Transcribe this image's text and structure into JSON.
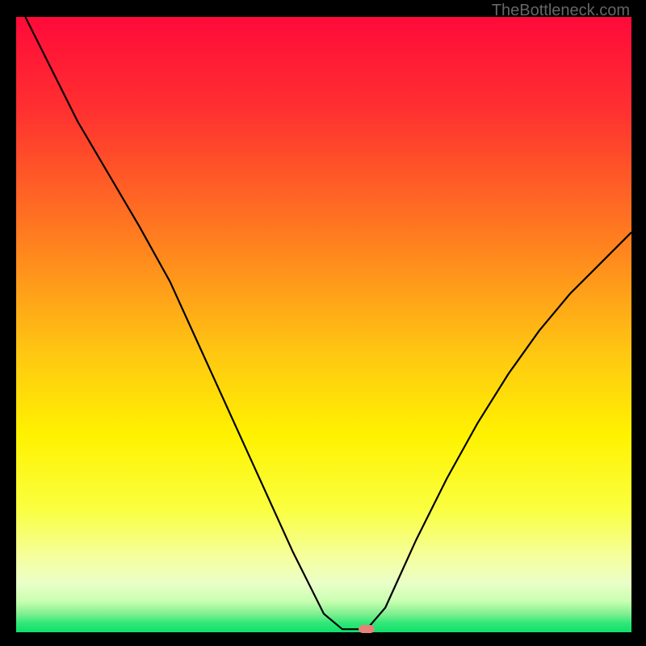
{
  "watermark": "TheBottleneck.com",
  "chart_data": {
    "type": "line",
    "title": "",
    "xlabel": "",
    "ylabel": "",
    "x_range": [
      0,
      100
    ],
    "y_range": [
      0,
      100
    ],
    "curve": [
      {
        "x": 1.5,
        "y": 100
      },
      {
        "x": 10,
        "y": 83
      },
      {
        "x": 20,
        "y": 66
      },
      {
        "x": 25,
        "y": 57
      },
      {
        "x": 30,
        "y": 46
      },
      {
        "x": 35,
        "y": 35
      },
      {
        "x": 40,
        "y": 24
      },
      {
        "x": 45,
        "y": 13
      },
      {
        "x": 50,
        "y": 3
      },
      {
        "x": 53,
        "y": 0.5
      },
      {
        "x": 57,
        "y": 0.5
      },
      {
        "x": 60,
        "y": 4
      },
      {
        "x": 65,
        "y": 15
      },
      {
        "x": 70,
        "y": 25
      },
      {
        "x": 75,
        "y": 34
      },
      {
        "x": 80,
        "y": 42
      },
      {
        "x": 85,
        "y": 49
      },
      {
        "x": 90,
        "y": 55
      },
      {
        "x": 95,
        "y": 60
      },
      {
        "x": 100,
        "y": 65
      }
    ],
    "marker": {
      "x": 57,
      "y": 0.5
    },
    "gradient_stops": [
      {
        "offset": 0,
        "color": "#ff0a3a"
      },
      {
        "offset": 15,
        "color": "#ff3030"
      },
      {
        "offset": 35,
        "color": "#ff7a20"
      },
      {
        "offset": 55,
        "color": "#ffc812"
      },
      {
        "offset": 68,
        "color": "#fff200"
      },
      {
        "offset": 80,
        "color": "#faff40"
      },
      {
        "offset": 88,
        "color": "#f5ffa0"
      },
      {
        "offset": 92,
        "color": "#eaffc8"
      },
      {
        "offset": 95,
        "color": "#c8ffb0"
      },
      {
        "offset": 97,
        "color": "#80ef90"
      },
      {
        "offset": 98.5,
        "color": "#30e878"
      },
      {
        "offset": 100,
        "color": "#10df6a"
      }
    ]
  }
}
